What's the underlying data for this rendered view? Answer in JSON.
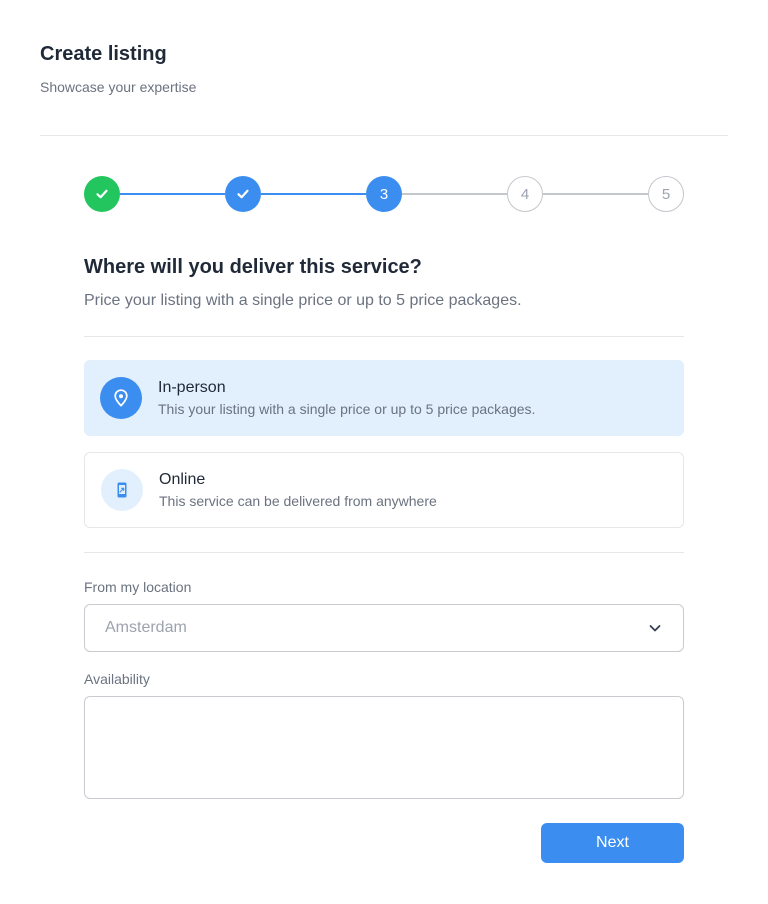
{
  "header": {
    "title": "Create listing",
    "subtitle": "Showcase your expertise"
  },
  "stepper": {
    "current_step": 3,
    "total_steps": 5,
    "steps": [
      {
        "label": "",
        "state": "complete"
      },
      {
        "label": "",
        "state": "complete"
      },
      {
        "label": "3",
        "state": "current"
      },
      {
        "label": "4",
        "state": "todo"
      },
      {
        "label": "5",
        "state": "todo"
      }
    ]
  },
  "question": {
    "title": "Where will you deliver this service?",
    "description": "Price your listing with a single price or up to 5 price packages."
  },
  "options": [
    {
      "title": "In-person",
      "description": "This your listing with a single price or up to 5 price packages.",
      "icon": "location-pin-icon",
      "selected": true
    },
    {
      "title": "Online",
      "description": "This service can be delivered from anywhere",
      "icon": "mobile-phone-icon",
      "selected": false
    }
  ],
  "location": {
    "label": "From my location",
    "value": "Amsterdam"
  },
  "availability": {
    "label": "Availability",
    "value": ""
  },
  "actions": {
    "next_label": "Next"
  },
  "colors": {
    "accent": "#3b8ef0",
    "success": "#22c55e",
    "selected_bg": "#e2f0fd",
    "inactive": "#c4c7cc"
  }
}
